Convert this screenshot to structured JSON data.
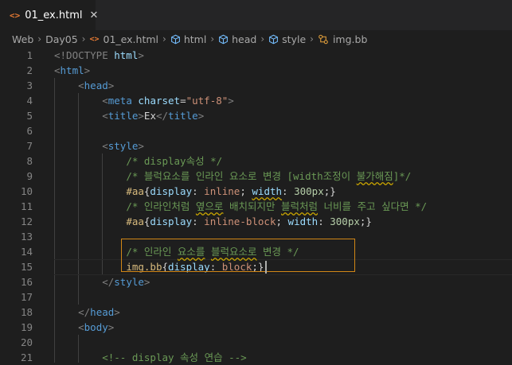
{
  "tab": {
    "icon": "<>",
    "label": "01_ex.html",
    "close": "✕"
  },
  "breadcrumb": {
    "items": [
      "Web",
      "Day05",
      "01_ex.html",
      "html",
      "head",
      "style",
      "img.bb"
    ],
    "html_icon": "<>",
    "separator": "›"
  },
  "icons": {
    "file": "html-file-icon",
    "element": "cube-icon",
    "selector": "tag-selector-icon"
  },
  "colors": {
    "find_highlight": "#d18616",
    "comment": "#6a9955",
    "tag": "#569cd6",
    "selector": "#d7ba7d"
  },
  "editor": {
    "line_numbers": [
      "1",
      "2",
      "3",
      "4",
      "5",
      "6",
      "7",
      "8",
      "9",
      "10",
      "11",
      "12",
      "13",
      "14",
      "15",
      "16",
      "17",
      "18",
      "19",
      "20",
      "21"
    ],
    "tokens": {
      "l1a": "<!DOCTYPE",
      "l1b": " html",
      "l1c": ">",
      "html": "html",
      "head": "head",
      "meta": "meta",
      "charset": "charset",
      "utf8": "\"utf-8\"",
      "title": "title",
      "title_text": "Ex",
      "style": "style",
      "body": "body",
      "c8": "/* display속성 */",
      "c9a": "/* 블럭요소를 인라인 요소로 변경 [width조정이 ",
      "c9b": "불가해짐",
      "c9c": "]*/",
      "sel_aa": "#aa",
      "display": "display",
      "inline": "inline",
      "width": "width",
      "w300": "300px",
      "c11a": "/* 인라인처럼 ",
      "c11b": "옆으로",
      "c11c": " 배치되지만 ",
      "c11d": "블럭처럼",
      "c11e": " 너비를 주고 싶다면 */",
      "inline_block": "inline-block",
      "c14a": "/* 인라인 ",
      "c14b": "요소를",
      "c14c": " ",
      "c14d": "블럭요소로",
      "c14e": " 변경 */",
      "sel_img": "img.bb",
      "block": "block",
      "c21": "<!-- display 속성 연습 -->"
    }
  }
}
